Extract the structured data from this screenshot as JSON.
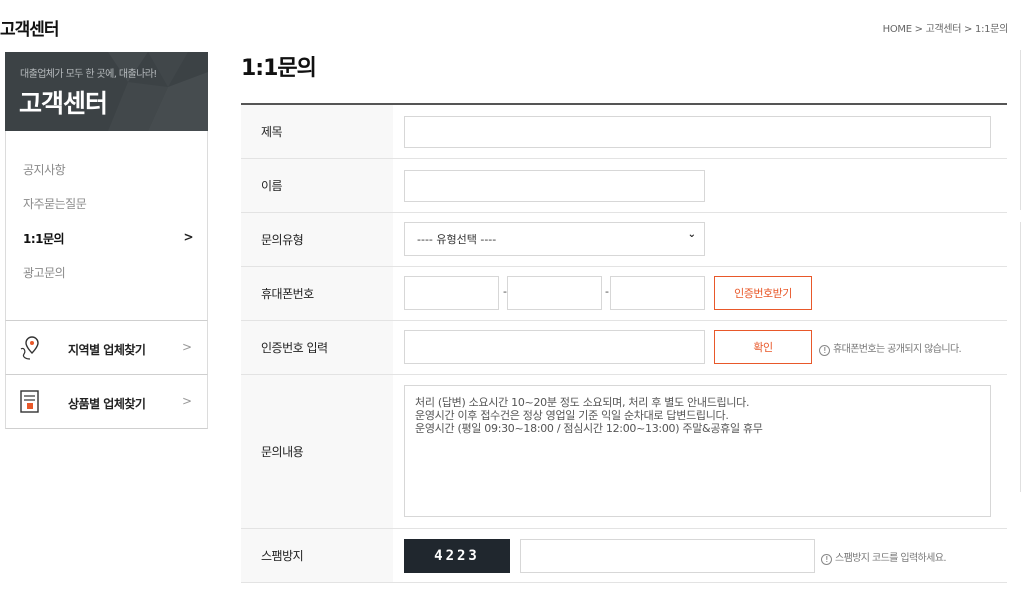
{
  "header": {
    "section_title": "고객센터",
    "breadcrumb": "HOME > 고객센터 > 1:1문의"
  },
  "sidebar": {
    "banner_sub": "대출업체가 모두 한 곳에, 대출나라!",
    "banner_title": "고객센터",
    "items": [
      {
        "label": "공지사항"
      },
      {
        "label": "자주묻는질문"
      },
      {
        "label": "1:1문의",
        "arrow": ">"
      },
      {
        "label": "광고문의"
      }
    ],
    "finders": [
      {
        "label": "지역별 업체찾기",
        "arrow": ">",
        "icon": "map-pin-icon"
      },
      {
        "label": "상품별 업체찾기",
        "arrow": ">",
        "icon": "document-icon"
      }
    ]
  },
  "main": {
    "title": "1:1문의",
    "form": {
      "subject_label": "제목",
      "subject_value": "",
      "name_label": "이름",
      "name_value": "",
      "type_label": "문의유형",
      "type_selected": "---- 유형선택 ----",
      "phone_label": "휴대폰번호",
      "phone_dash": "-",
      "request_code_button": "인증번호받기",
      "code_label": "인증번호 입력",
      "confirm_button": "확인",
      "phone_note_icon": "!",
      "phone_note": "휴대폰번호는 공개되지 않습니다.",
      "content_label": "문의내용",
      "content_placeholder": "처리 (답변) 소요시간 10~20분 정도 소요되며, 처리 후 별도 안내드립니다.\n운영시간 이후 접수건은 정상 영업일 기준 익일 순차대로 답변드립니다.\n운영시간 (평일 09:30~18:00 / 점심시간 12:00~13:00) 주말&공휴일 휴무",
      "spam_label": "스팸방지",
      "captcha_code": "4223",
      "spam_note_icon": "!",
      "spam_note": "스팸방지 코드를 입력하세요."
    }
  },
  "colors": {
    "banner_bg": "#3c4245",
    "accent_orange": "#e8582a",
    "captcha_bg": "#20272e"
  }
}
